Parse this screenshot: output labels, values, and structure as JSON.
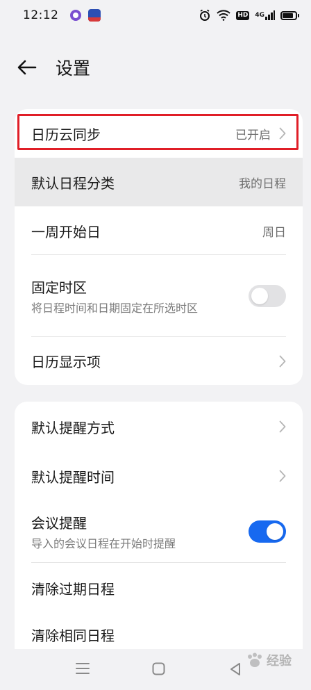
{
  "status_bar": {
    "time": "12:12",
    "network_label": "4G",
    "hd_label": "HD"
  },
  "header": {
    "title": "设置"
  },
  "section1": {
    "cloud_sync": {
      "label": "日历云同步",
      "value": "已开启"
    },
    "default_category": {
      "label": "默认日程分类",
      "value": "我的日程"
    },
    "week_start": {
      "label": "一周开始日",
      "value": "周日"
    },
    "fixed_timezone": {
      "label": "固定时区",
      "subtitle": "将日程时间和日期固定在所选时区",
      "enabled": false
    },
    "display_items": {
      "label": "日历显示项"
    }
  },
  "section2": {
    "reminder_method": {
      "label": "默认提醒方式"
    },
    "reminder_time": {
      "label": "默认提醒时间"
    },
    "meeting_reminder": {
      "label": "会议提醒",
      "subtitle": "导入的会议日程在开始时提醒",
      "enabled": true
    },
    "clear_expired": {
      "label": "清除过期日程"
    },
    "clear_duplicate": {
      "label": "清除相同日程"
    }
  },
  "watermark": {
    "text": "经验"
  },
  "colors": {
    "accent": "#1769f0",
    "highlight_border": "#e01e27",
    "background": "#f2f2f4"
  }
}
